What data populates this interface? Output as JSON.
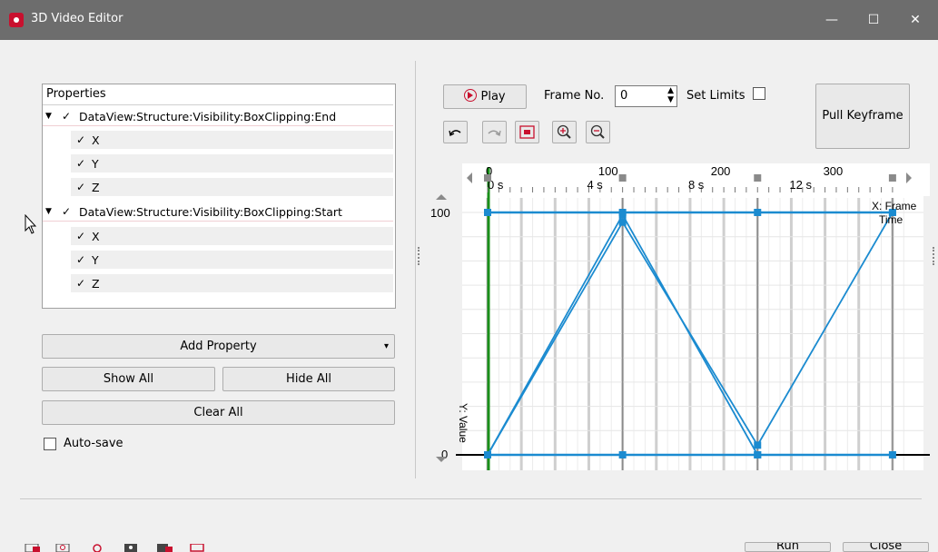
{
  "window": {
    "title": "3D Video Editor",
    "controls": {
      "minimize": "—",
      "maximize": "☐",
      "close": "✕"
    }
  },
  "properties_panel": {
    "header": "Properties",
    "groups": [
      {
        "label": "DataView:Structure:Visibility:BoxClipping:End",
        "checked": true,
        "children": [
          "X",
          "Y",
          "Z"
        ]
      },
      {
        "label": "DataView:Structure:Visibility:BoxClipping:Start",
        "checked": true,
        "children": [
          "X",
          "Y",
          "Z"
        ]
      }
    ],
    "check_mark": "✓"
  },
  "buttons": {
    "add_property": "Add Property",
    "add_property_arrow": "▾",
    "show_all": "Show All",
    "hide_all": "Hide All",
    "clear_all": "Clear All",
    "auto_save": "Auto-save",
    "run": "Run",
    "close": "Close"
  },
  "toolbar": {
    "play": "Play",
    "frame_label": "Frame No.",
    "frame_value": "0",
    "set_limits": "Set Limits",
    "pull_keyframe": "Pull Keyframe"
  },
  "chart_data": {
    "type": "line",
    "x_label": "X: Frame",
    "x_label2": "Time",
    "y_label": "Y: Value",
    "xlim": [
      -2,
      368
    ],
    "ylim": [
      0,
      100
    ],
    "top_ticks": [
      "0",
      "100",
      "200",
      "300"
    ],
    "bottom_ticks": [
      "0 s",
      "4 s",
      "8 s",
      "12 s"
    ],
    "y_ticks": [
      "100",
      "0"
    ],
    "keyframes_x": [
      0,
      120,
      240,
      360
    ],
    "series": [
      {
        "x": [
          0,
          120,
          240,
          360
        ],
        "y": [
          100,
          100,
          100,
          100
        ]
      },
      {
        "x": [
          0,
          120,
          240,
          360
        ],
        "y": [
          0,
          0,
          0,
          0
        ]
      },
      {
        "x": [
          0,
          120,
          240,
          360
        ],
        "y": [
          0,
          96,
          4,
          100
        ]
      },
      {
        "x": [
          0,
          120,
          240
        ],
        "y": [
          0,
          99,
          0
        ]
      }
    ],
    "colors": {
      "line": "#1b8bd0",
      "current_frame": "#1a8f1a",
      "axis": "#000000"
    }
  }
}
